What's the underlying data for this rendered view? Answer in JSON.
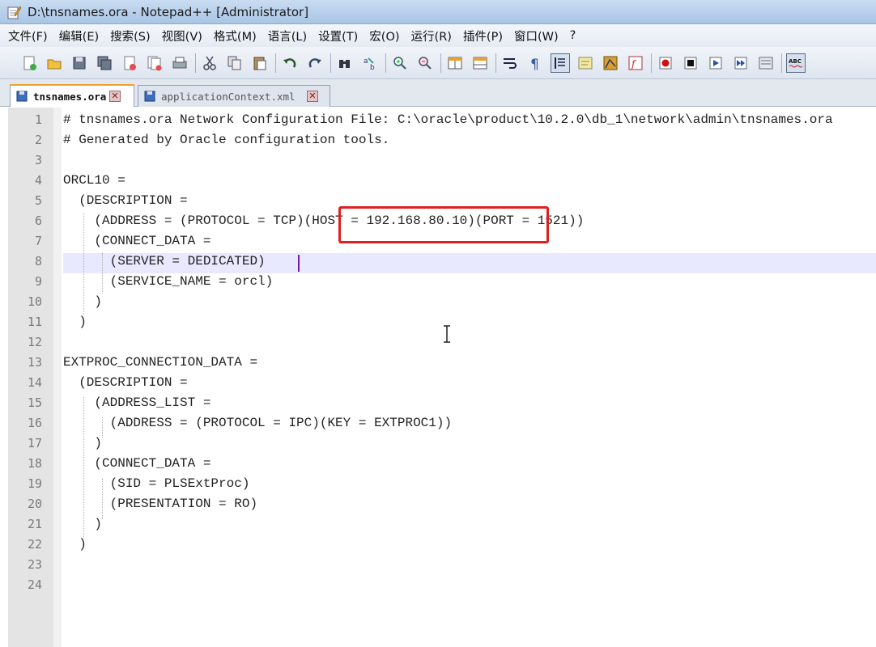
{
  "window": {
    "title": "D:\\tnsnames.ora - Notepad++ [Administrator]"
  },
  "menu": [
    "文件(F)",
    "编辑(E)",
    "搜索(S)",
    "视图(V)",
    "格式(M)",
    "语言(L)",
    "设置(T)",
    "宏(O)",
    "运行(R)",
    "插件(P)",
    "窗口(W)",
    "?"
  ],
  "toolbar": {
    "icons": [
      "new-file-icon",
      "open-file-icon",
      "save-icon",
      "save-all-icon",
      "close-icon",
      "close-all-icon",
      "print-icon",
      "cut-icon",
      "copy-icon",
      "paste-icon",
      "undo-icon",
      "redo-icon",
      "find-icon",
      "replace-icon",
      "zoom-in-icon",
      "zoom-out-icon",
      "sync-vertical-icon",
      "sync-horizontal-icon",
      "word-wrap-icon",
      "show-all-chars-icon",
      "indent-guide-icon",
      "user-lang-icon",
      "doc-map-icon",
      "function-list-icon",
      "record-macro-icon",
      "stop-macro-icon",
      "play-macro-icon",
      "run-macro-multiple-icon",
      "save-macro-icon",
      "spellcheck-icon"
    ]
  },
  "tabs": [
    {
      "label": "tnsnames.ora",
      "active": true
    },
    {
      "label": "applicationContext.xml",
      "active": false
    }
  ],
  "editor": {
    "line_numbers": [
      "1",
      "2",
      "3",
      "4",
      "5",
      "6",
      "7",
      "8",
      "9",
      "10",
      "11",
      "12",
      "13",
      "14",
      "15",
      "16",
      "17",
      "18",
      "19",
      "20",
      "21",
      "22",
      "23",
      "24"
    ],
    "lines": [
      "# tnsnames.ora Network Configuration File: C:\\oracle\\product\\10.2.0\\db_1\\network\\admin\\tnsnames.ora",
      "# Generated by Oracle configuration tools.",
      "",
      "ORCL10 =",
      "  (DESCRIPTION =",
      "    (ADDRESS = (PROTOCOL = TCP)(HOST = 192.168.80.10)(PORT = 1521))",
      "    (CONNECT_DATA =",
      "      (SERVER = DEDICATED)",
      "      (SERVICE_NAME = orcl)",
      "    )",
      "  )",
      "",
      "EXTPROC_CONNECTION_DATA =",
      "  (DESCRIPTION =",
      "    (ADDRESS_LIST =",
      "      (ADDRESS = (PROTOCOL = IPC)(KEY = EXTPROC1))",
      "    )",
      "    (CONNECT_DATA =",
      "      (SID = PLSExtProc)",
      "      (PRESENTATION = RO)",
      "    )",
      "  )",
      "",
      ""
    ],
    "current_line": 8,
    "highlighted_text": "(HOST = 192.168.80.10)"
  }
}
